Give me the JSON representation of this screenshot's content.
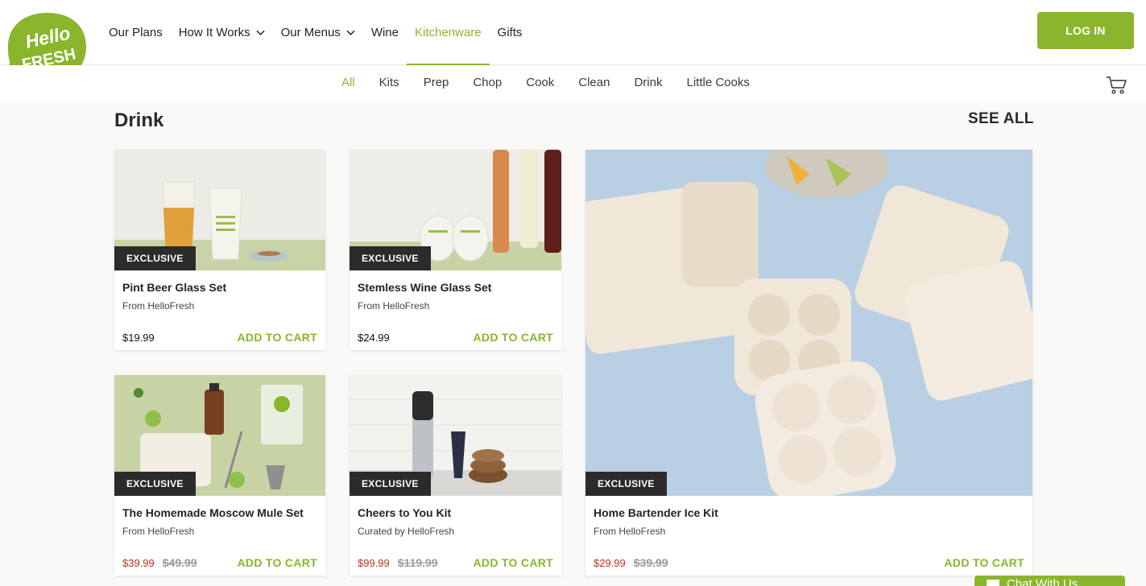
{
  "brand": {
    "logo_line1": "Hello",
    "logo_line2": "FRESH",
    "accent": "#8ab52d",
    "sale_color": "#b8321b"
  },
  "nav": {
    "items": [
      {
        "label": "Our Plans",
        "dropdown": false,
        "active": false
      },
      {
        "label": "How It Works",
        "dropdown": true,
        "active": false
      },
      {
        "label": "Our Menus",
        "dropdown": true,
        "active": false
      },
      {
        "label": "Wine",
        "dropdown": false,
        "active": false
      },
      {
        "label": "Kitchenware",
        "dropdown": false,
        "active": true
      },
      {
        "label": "Gifts",
        "dropdown": false,
        "active": false
      }
    ],
    "login_label": "LOG IN"
  },
  "subnav": {
    "items": [
      "All",
      "Kits",
      "Prep",
      "Chop",
      "Cook",
      "Clean",
      "Drink",
      "Little Cooks"
    ],
    "active": "All",
    "cart_icon": "cart-icon"
  },
  "section": {
    "title": "Drink",
    "see_all": "SEE ALL"
  },
  "products": [
    {
      "badge": "EXCLUSIVE",
      "title": "Pint Beer Glass Set",
      "from": "From HelloFresh",
      "price": "$19.99",
      "orig_price": "",
      "cta": "ADD TO CART"
    },
    {
      "badge": "EXCLUSIVE",
      "title": "Stemless Wine Glass Set",
      "from": "From HelloFresh",
      "price": "$24.99",
      "orig_price": "",
      "cta": "ADD TO CART"
    },
    {
      "badge": "EXCLUSIVE",
      "title": "The Homemade Moscow Mule Set",
      "from": "From HelloFresh",
      "price": "$39.99",
      "orig_price": "$49.99",
      "cta": "ADD TO CART"
    },
    {
      "badge": "EXCLUSIVE",
      "title": "Cheers to You Kit",
      "from": "Curated by HelloFresh",
      "price": "$99.99",
      "orig_price": "$119.99",
      "cta": "ADD TO CART"
    },
    {
      "badge": "EXCLUSIVE",
      "title": "Home Bartender Ice Kit",
      "from": "From HelloFresh",
      "price": "$29.99",
      "orig_price": "$39.99",
      "cta": "ADD TO CART"
    }
  ],
  "chat": {
    "label": "Chat With Us"
  }
}
